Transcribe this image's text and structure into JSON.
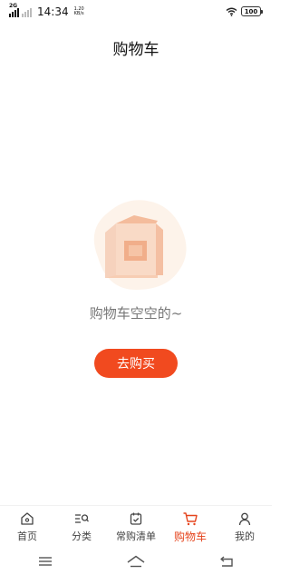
{
  "status_bar": {
    "network_label": "2G",
    "time": "14:34",
    "speed_value": "1.20",
    "speed_unit": "KB/s",
    "battery": "100"
  },
  "header": {
    "title": "购物车"
  },
  "empty_state": {
    "message": "购物车空空的~",
    "button_label": "去购买"
  },
  "tabbar": {
    "items": [
      {
        "label": "首页",
        "icon": "home-icon",
        "active": false
      },
      {
        "label": "分类",
        "icon": "category-icon",
        "active": false
      },
      {
        "label": "常购清单",
        "icon": "list-icon",
        "active": false
      },
      {
        "label": "购物车",
        "icon": "cart-icon",
        "active": true
      },
      {
        "label": "我的",
        "icon": "profile-icon",
        "active": false
      }
    ]
  },
  "system_nav": {
    "icons": [
      "menu-icon",
      "home-outline-icon",
      "back-icon"
    ]
  },
  "colors": {
    "accent": "#f14a1f",
    "active_tab": "#e5441d",
    "illustration_bg": "#fdf3ea"
  }
}
